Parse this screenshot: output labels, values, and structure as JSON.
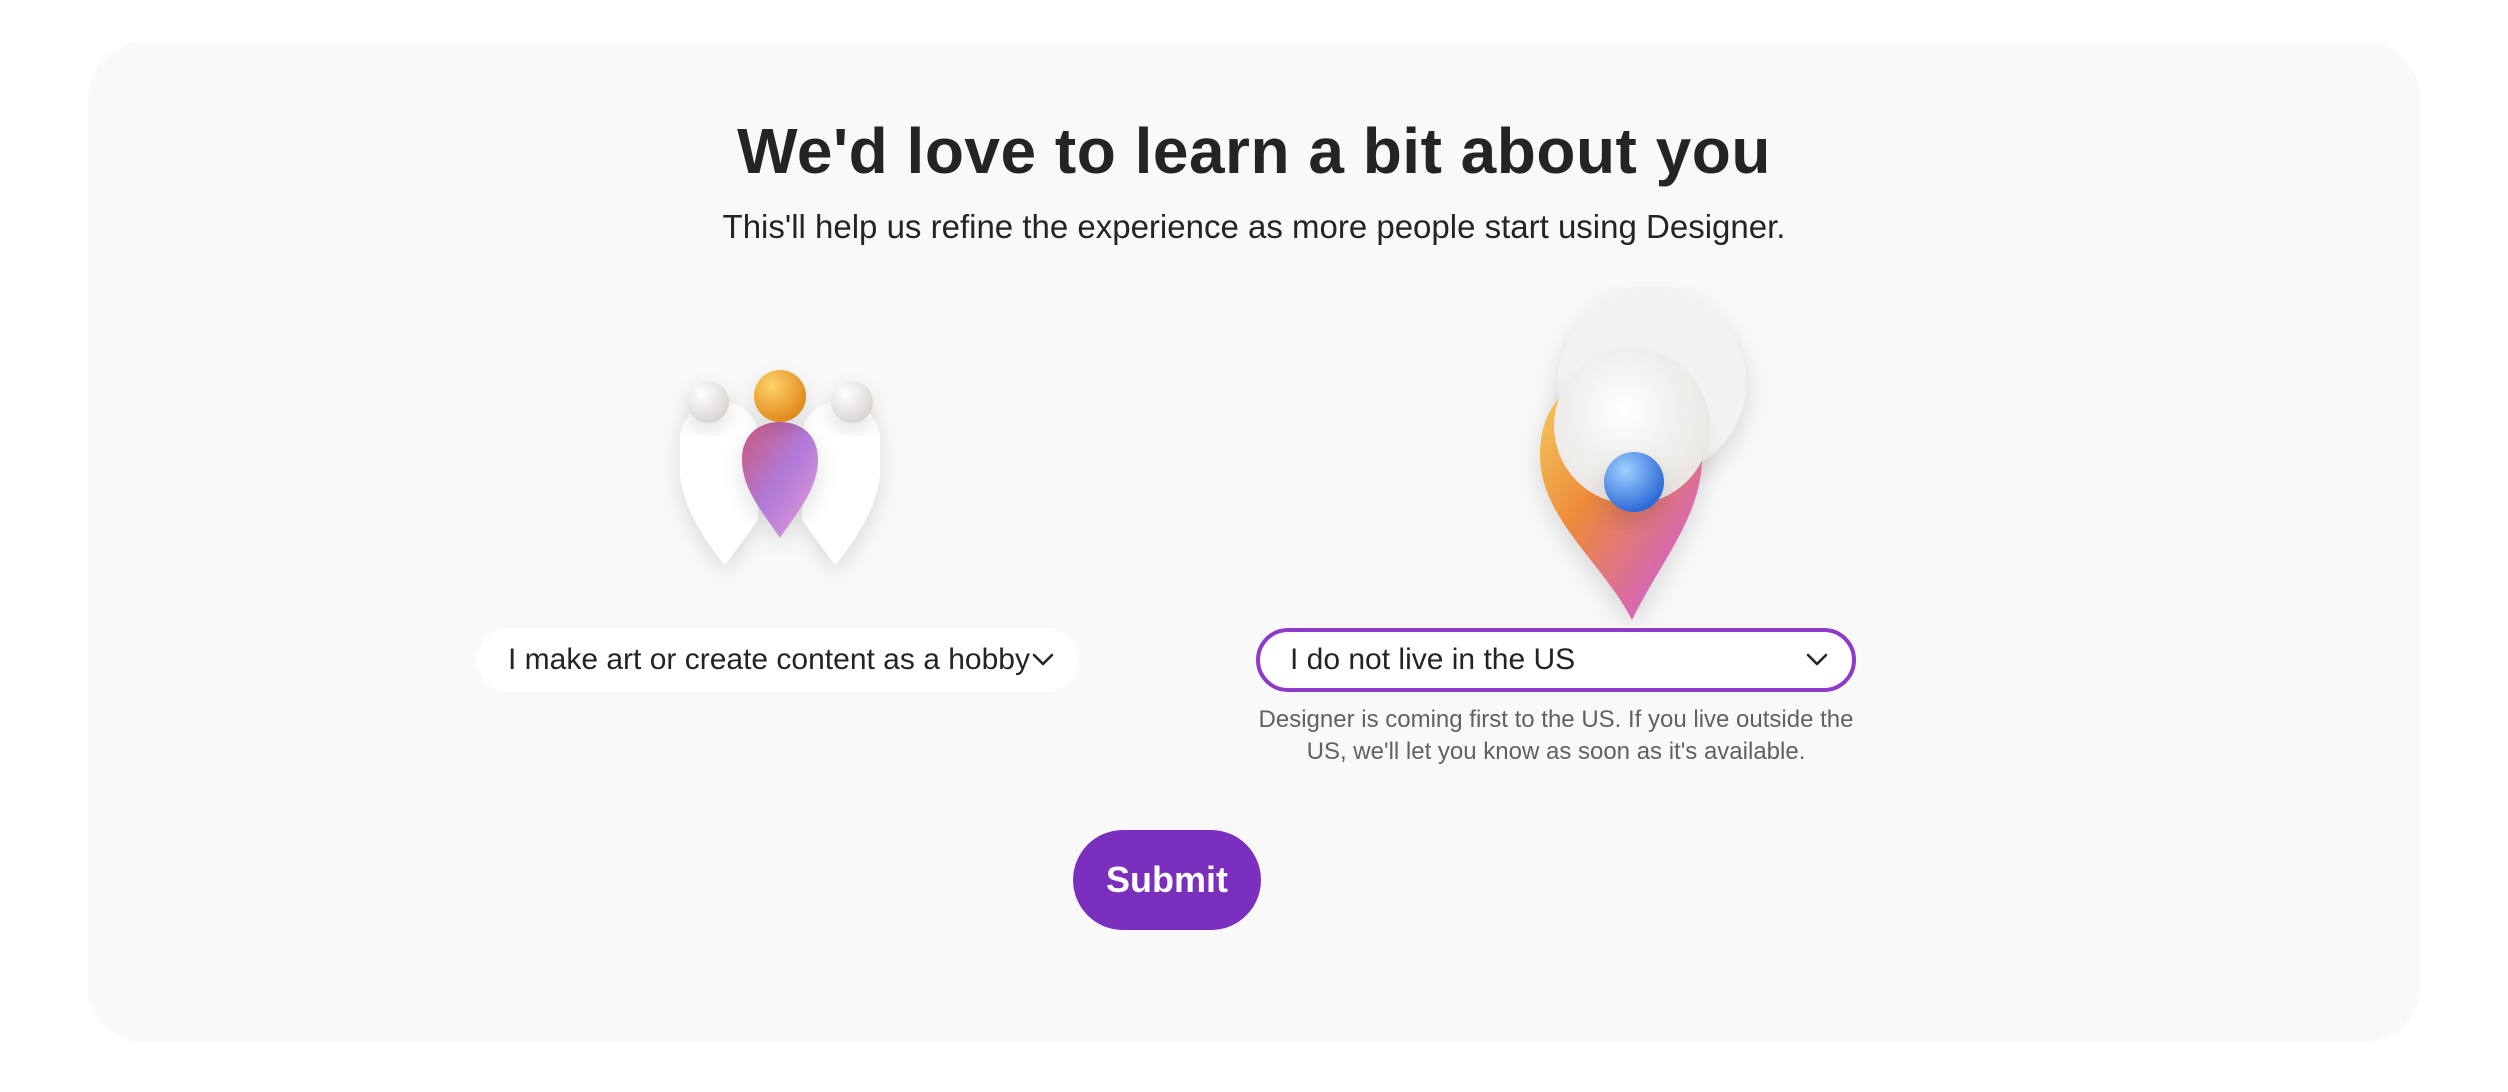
{
  "heading": {
    "title": "We'd love to learn a bit about you",
    "subtitle": "This'll help us refine the experience as more people start using Designer."
  },
  "illustrations": {
    "left_icon": "people-community-icon",
    "right_icon": "location-pin-icon"
  },
  "role_select": {
    "value": "I make art or create content as a hobby",
    "icon": "chevron-down-icon"
  },
  "location_select": {
    "value": "I do not live in the US",
    "icon": "chevron-down-icon",
    "helper_text": "Designer is coming first to the US. If you live outside the US, we'll let you know as soon as it's available."
  },
  "submit": {
    "label": "Submit"
  },
  "colors": {
    "accent": "#7b2fbe",
    "focus_border": "#8f3ac8",
    "card_background": "#f9f9f9",
    "text": "#242424"
  }
}
